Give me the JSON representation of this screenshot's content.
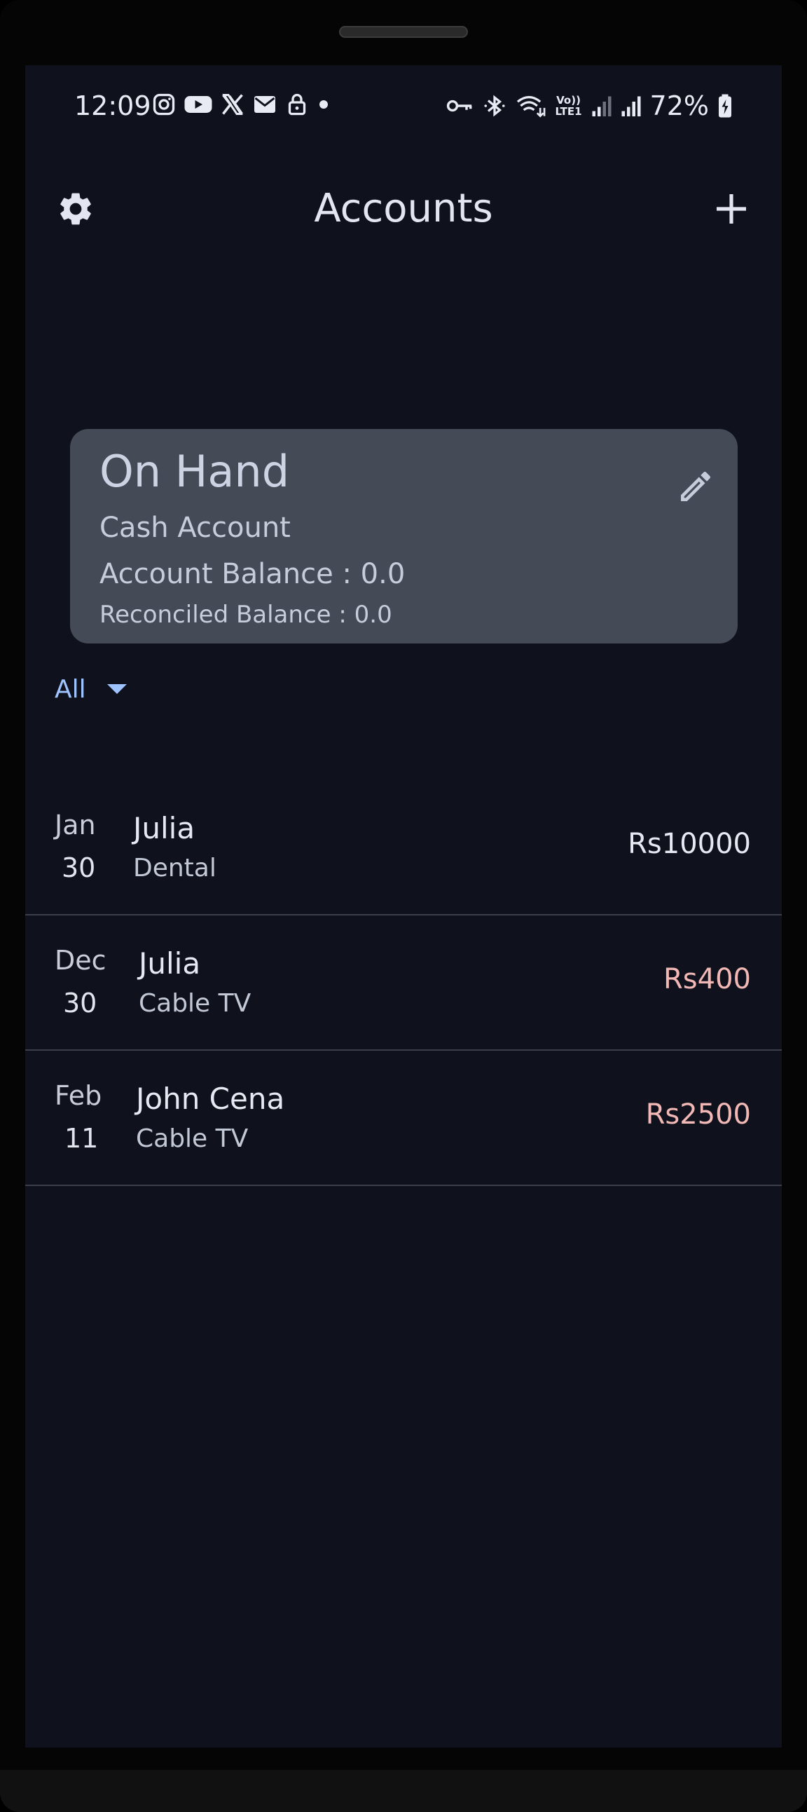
{
  "status_bar": {
    "time": "12:09",
    "network_label": "Vo)) LTE1",
    "battery": "72%"
  },
  "app_bar": {
    "title": "Accounts",
    "left_icon": "gear-icon",
    "right_icon": "plus-icon"
  },
  "account_card": {
    "name": "On Hand",
    "type": "Cash Account",
    "balance": "Account Balance : 0.0",
    "reconciled": "Reconciled Balance : 0.0",
    "edit_icon": "pencil-icon"
  },
  "filter": {
    "label": "All"
  },
  "transactions": [
    {
      "month": "Jan",
      "day": "30",
      "payee": "Julia",
      "category": "Dental",
      "amount": "Rs10000",
      "color": "#e6e9f2"
    },
    {
      "month": "Dec",
      "day": "30",
      "payee": "Julia",
      "category": "Cable TV",
      "amount": "Rs400",
      "color": "#f2b8b5"
    },
    {
      "month": "Feb",
      "day": "11",
      "payee": "John Cena",
      "category": "Cable TV",
      "amount": "Rs2500",
      "color": "#f2b8b5"
    }
  ],
  "colors": {
    "background": "#0f121d",
    "card": "#444a56",
    "accent": "#9fc3ff",
    "expense": "#f2b8b5"
  }
}
